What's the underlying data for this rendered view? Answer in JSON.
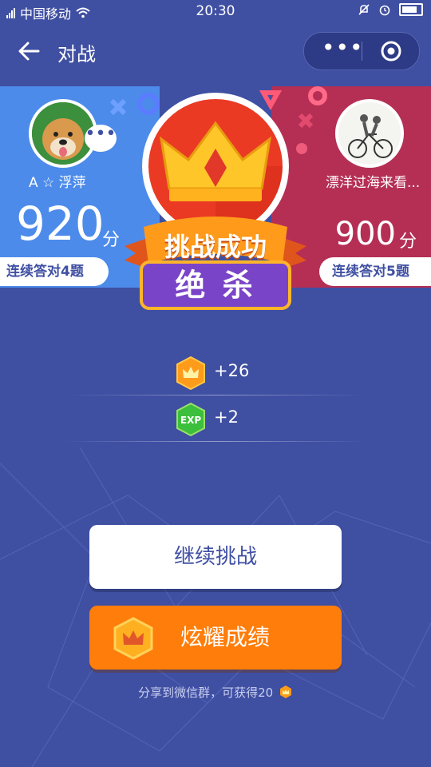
{
  "status_bar": {
    "carrier": "中国移动",
    "time": "20:30"
  },
  "nav": {
    "title": "对战"
  },
  "player_left": {
    "name": "A ☆ 浮萍",
    "score": "920",
    "unit": "分",
    "streak": "连续答对4题"
  },
  "player_right": {
    "name": "漂洋过海来看...",
    "score": "900",
    "unit": "分",
    "streak": "连续答对5题"
  },
  "result": {
    "title": "挑战成功",
    "subtitle": "绝 杀"
  },
  "rewards": [
    {
      "icon": "crown-coin-icon",
      "value": "+26"
    },
    {
      "icon": "exp-icon",
      "icon_text": "EXP",
      "value": "+2"
    }
  ],
  "buttons": {
    "continue": "继续挑战",
    "show_off": "炫耀成绩"
  },
  "share_hint": "分享到微信群，可获得20",
  "colors": {
    "background": "#3f4fa2",
    "left_panel": "#4c8bea",
    "right_panel": "#b52f55",
    "orange": "#ff7d0a"
  }
}
